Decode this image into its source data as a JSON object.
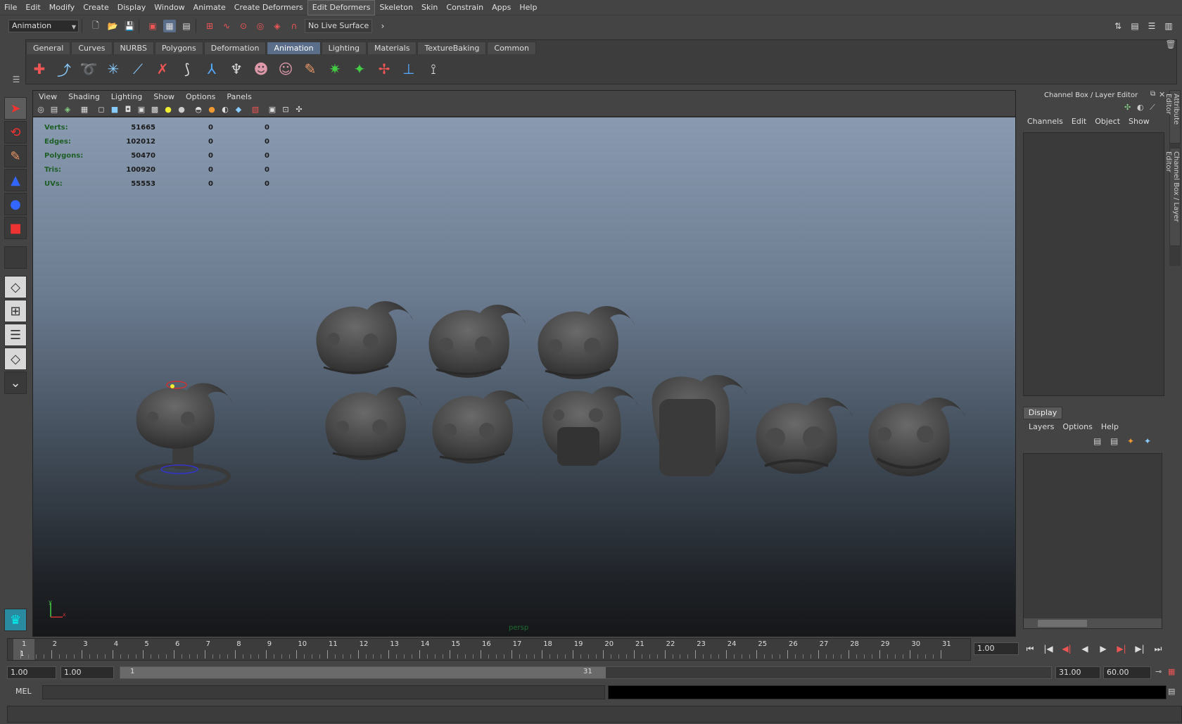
{
  "menubar": [
    "File",
    "Edit",
    "Modify",
    "Create",
    "Display",
    "Window",
    "Animate",
    "Create Deformers",
    "Edit Deformers",
    "Skeleton",
    "Skin",
    "Constrain",
    "Apps",
    "Help"
  ],
  "status": {
    "mode": "Animation",
    "live_surface": "No Live Surface"
  },
  "shelf": {
    "tabs": [
      "General",
      "Curves",
      "NURBS",
      "Polygons",
      "Deformation",
      "Animation",
      "Lighting",
      "Materials",
      "TextureBaking",
      "Common"
    ],
    "active": "Animation"
  },
  "viewport": {
    "menu": [
      "View",
      "Shading",
      "Lighting",
      "Show",
      "Options",
      "Panels"
    ],
    "camera": "persp",
    "hud": [
      {
        "k": "Verts:",
        "v": "51665",
        "a": "0",
        "b": "0"
      },
      {
        "k": "Edges:",
        "v": "102012",
        "a": "0",
        "b": "0"
      },
      {
        "k": "Polygons:",
        "v": "50470",
        "a": "0",
        "b": "0"
      },
      {
        "k": "Tris:",
        "v": "100920",
        "a": "0",
        "b": "0"
      },
      {
        "k": "UVs:",
        "v": "55553",
        "a": "0",
        "b": "0"
      }
    ]
  },
  "rightpanel": {
    "title": "Channel Box / Layer Editor",
    "menu": [
      "Channels",
      "Edit",
      "Object",
      "Show"
    ],
    "display_tab": "Display",
    "display_menu": [
      "Layers",
      "Options",
      "Help"
    ]
  },
  "sidetabs": [
    "Attribute Editor",
    "Channel Box / Layer Editor"
  ],
  "timeline": {
    "ticks": [
      "1",
      "2",
      "3",
      "4",
      "5",
      "6",
      "7",
      "8",
      "9",
      "10",
      "11",
      "12",
      "13",
      "14",
      "15",
      "16",
      "17",
      "18",
      "19",
      "20",
      "21",
      "22",
      "23",
      "24",
      "25",
      "26",
      "27",
      "28",
      "29",
      "30",
      "31"
    ],
    "current": "1",
    "current_field": "1.00"
  },
  "range": {
    "start": "1.00",
    "anim_start": "1.00",
    "bar_start": "1",
    "bar_end": "31",
    "end": "31.00",
    "anim_end": "60.00"
  },
  "mel": {
    "label": "MEL"
  }
}
